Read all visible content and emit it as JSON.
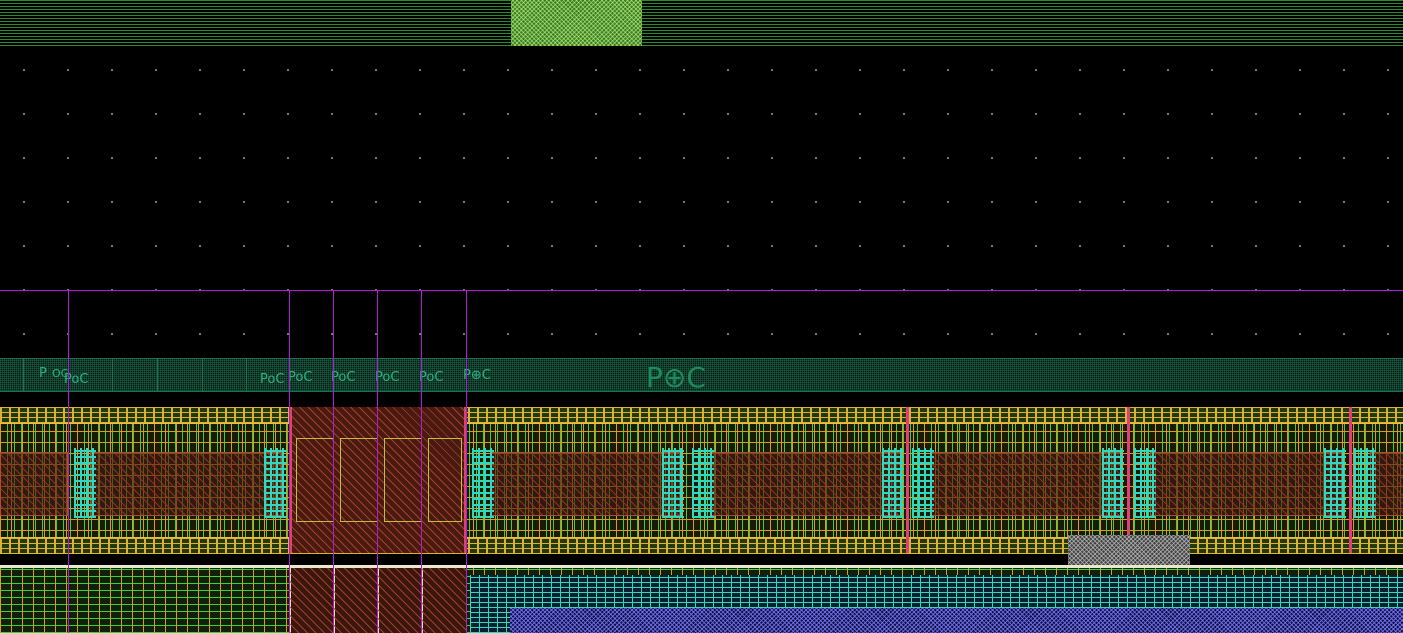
{
  "canvas": {
    "top_pad_label": "",
    "poc_labels": [
      "P",
      "OC",
      "PoC",
      "PoC",
      "PoC",
      "PoC",
      "PoC",
      "PoC"
    ],
    "poc_big_label": "P⊕C"
  },
  "colors": {
    "background": "#000000",
    "grid_dots": "#8a8a8a",
    "metal_green": "#3ad23a",
    "metal_gold": "#d2a020",
    "boundary_purple": "#b01cd4",
    "boundary_pink": "#e0407a",
    "poc_teal": "#2db080",
    "cyan_layer": "#30d8c0",
    "poly_brown": "#a85030",
    "blue_layer": "#7878ff"
  }
}
